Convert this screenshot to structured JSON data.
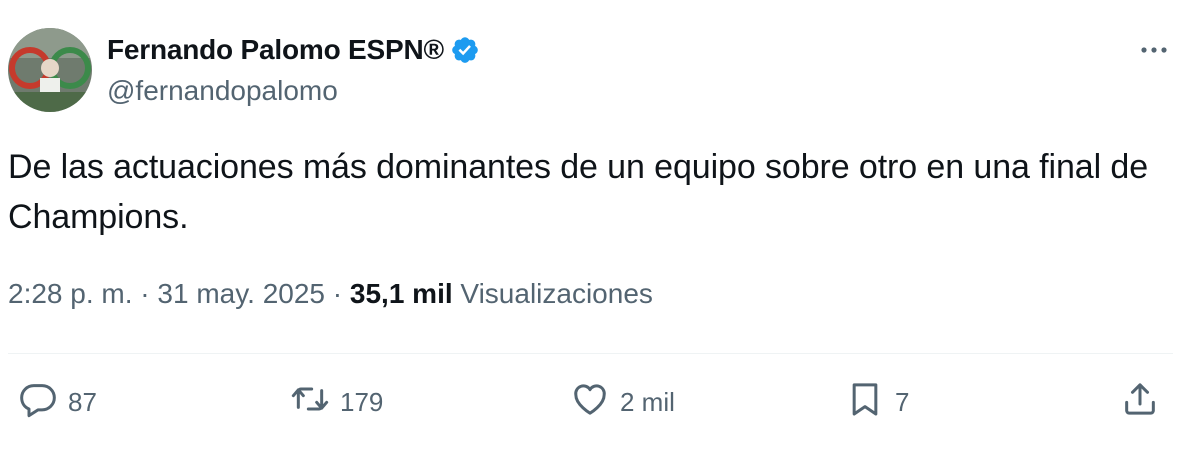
{
  "author": {
    "display_name": "Fernando Palomo ESPN®",
    "handle": "@fernandopalomo",
    "verified": true
  },
  "tweet": {
    "text": "De las actuaciones más dominantes de un equipo sobre otro en una final de Champions."
  },
  "meta": {
    "time": "2:28 p. m.",
    "separator": "·",
    "date": "31 may. 2025",
    "views_count": "35,1 mil",
    "views_label": "Visualizaciones"
  },
  "actions": {
    "replies": "87",
    "retweets": "179",
    "likes": "2 mil",
    "bookmarks": "7"
  },
  "colors": {
    "text": "#0f1419",
    "secondary": "#536471",
    "verified": "#1d9bf0",
    "divider": "#eff3f4"
  }
}
